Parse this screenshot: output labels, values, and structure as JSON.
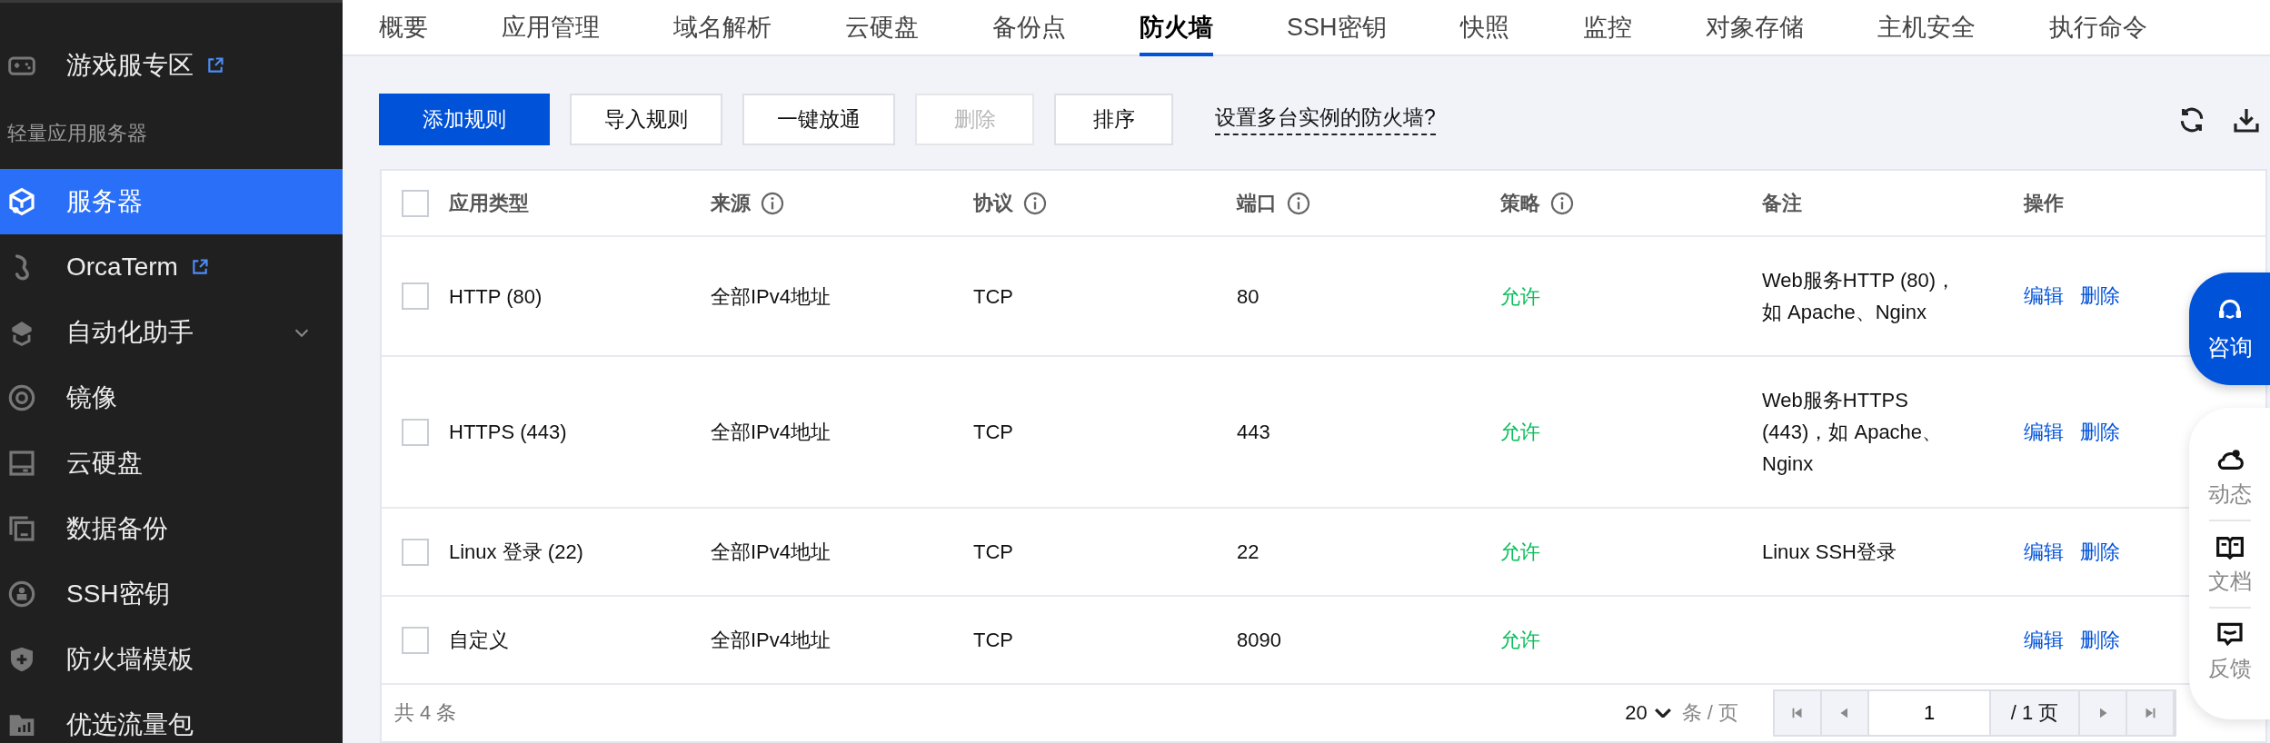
{
  "sidebar": {
    "items": [
      {
        "kind": "item",
        "label": "游戏服专区",
        "selected": false,
        "external": true
      },
      {
        "kind": "heading",
        "label": "轻量应用服务器"
      },
      {
        "kind": "item",
        "label": "服务器",
        "selected": true
      },
      {
        "kind": "item",
        "label": "OrcaTerm",
        "selected": false,
        "external": true
      },
      {
        "kind": "item",
        "label": "自动化助手",
        "selected": false,
        "expanded": false
      },
      {
        "kind": "item",
        "label": "镜像",
        "selected": false
      },
      {
        "kind": "item",
        "label": "云硬盘",
        "selected": false
      },
      {
        "kind": "item",
        "label": "数据备份",
        "selected": false
      },
      {
        "kind": "item",
        "label": "SSH密钥",
        "selected": false
      },
      {
        "kind": "item",
        "label": "防火墙模板",
        "selected": false
      },
      {
        "kind": "item",
        "label": "优选流量包",
        "selected": false
      }
    ]
  },
  "tabs": [
    {
      "label": "概要",
      "selected": false
    },
    {
      "label": "应用管理",
      "selected": false
    },
    {
      "label": "域名解析",
      "selected": false
    },
    {
      "label": "云硬盘",
      "selected": false
    },
    {
      "label": "备份点",
      "selected": false
    },
    {
      "label": "防火墙",
      "selected": true
    },
    {
      "label": "SSH密钥",
      "selected": false
    },
    {
      "label": "快照",
      "selected": false
    },
    {
      "label": "监控",
      "selected": false
    },
    {
      "label": "对象存储",
      "selected": false
    },
    {
      "label": "主机安全",
      "selected": false
    },
    {
      "label": "执行命令",
      "selected": false
    }
  ],
  "toolbar": {
    "buttons": [
      {
        "label": "添加规则",
        "kind": "primary",
        "disabled": false
      },
      {
        "label": "导入规则",
        "kind": "default",
        "disabled": false
      },
      {
        "label": "一键放通",
        "kind": "default",
        "disabled": false
      },
      {
        "label": "删除",
        "kind": "default",
        "disabled": true
      },
      {
        "label": "排序",
        "kind": "default",
        "disabled": false
      }
    ],
    "help_link": "设置多台实例的防火墙?"
  },
  "table": {
    "all_checked": false,
    "columns": [
      {
        "label": "应用类型",
        "info": false
      },
      {
        "label": "来源",
        "info": true
      },
      {
        "label": "协议",
        "info": true
      },
      {
        "label": "端口",
        "info": true
      },
      {
        "label": "策略",
        "info": true
      },
      {
        "label": "备注",
        "info": false
      },
      {
        "label": "操作",
        "info": false
      }
    ],
    "rows": [
      {
        "checked": false,
        "type": "HTTP (80)",
        "source": "全部IPv4地址",
        "protocol": "TCP",
        "port": "80",
        "policy": "允许",
        "note": "Web服务HTTP (80)，如 Apache、Nginx",
        "actions": [
          "编辑",
          "删除"
        ]
      },
      {
        "checked": false,
        "type": "HTTPS (443)",
        "source": "全部IPv4地址",
        "protocol": "TCP",
        "port": "443",
        "policy": "允许",
        "note": "Web服务HTTPS (443)，如 Apache、Nginx",
        "actions": [
          "编辑",
          "删除"
        ]
      },
      {
        "checked": false,
        "type": "Linux 登录 (22)",
        "source": "全部IPv4地址",
        "protocol": "TCP",
        "port": "22",
        "policy": "允许",
        "note": "Linux SSH登录",
        "actions": [
          "编辑",
          "删除"
        ]
      },
      {
        "checked": false,
        "type": "自定义",
        "source": "全部IPv4地址",
        "protocol": "TCP",
        "port": "8090",
        "policy": "允许",
        "actions": [
          "编辑",
          "删除"
        ]
      }
    ]
  },
  "pagination": {
    "total": "共 4 条",
    "page_size": "20",
    "per_page": "条 / 页",
    "page": "1",
    "page_total": "/ 1 页"
  },
  "float_panel": {
    "consult": "咨询",
    "items": [
      "动态",
      "文档",
      "反馈"
    ]
  }
}
